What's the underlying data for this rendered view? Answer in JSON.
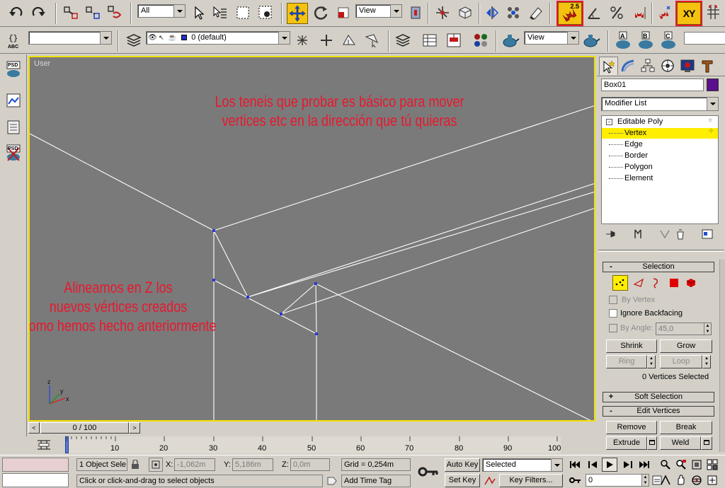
{
  "toolbar": {
    "selection_filter": "All",
    "ref_coord": "View",
    "snap_label": "2.5",
    "axis_label": "XY",
    "named_sel_placeholder": "",
    "pivot_view": "View",
    "render_a": "A",
    "render_b": "B",
    "render_c": "C"
  },
  "layer_bar": {
    "layer_name": "0 (default)",
    "name_field": "",
    "abc_label": "ABC"
  },
  "left_dock": {
    "psd1": "PSD",
    "psd2": "PSD"
  },
  "viewport": {
    "label": "User",
    "annotation_top": [
      "Los teneis que probar es básico para mover",
      "vertices etc en la dirección que tú quieras"
    ],
    "annotation_left": [
      "Alineamos en Z los",
      "nuevos vértices creados",
      "como hemos hecho anteriormente"
    ],
    "axis_x": "x",
    "axis_y": "y",
    "axis_z": "z"
  },
  "command_panel": {
    "object_name": "Box01",
    "object_color": "#5a0f8c",
    "modifier_list": "Modifier List",
    "stack": [
      {
        "label": "Editable Poly",
        "selected": false
      },
      {
        "label": "Vertex",
        "selected": true
      },
      {
        "label": "Edge",
        "selected": false
      },
      {
        "label": "Border",
        "selected": false
      },
      {
        "label": "Polygon",
        "selected": false
      },
      {
        "label": "Element",
        "selected": false
      }
    ],
    "selection": {
      "title": "Selection",
      "sign": "-",
      "by_vertex": "By Vertex",
      "ignore_backfacing": "Ignore Backfacing",
      "by_angle": "By Angle:",
      "angle_value": "45,0",
      "shrink": "Shrink",
      "grow": "Grow",
      "ring": "Ring",
      "loop": "Loop",
      "status": "0 Vertices Selected"
    },
    "soft_selection": {
      "title": "Soft Selection",
      "sign": "+"
    },
    "edit_vertices": {
      "title": "Edit Vertices",
      "sign": "-",
      "remove": "Remove",
      "break": "Break",
      "extrude": "Extrude",
      "weld": "Weld"
    }
  },
  "timeline": {
    "frame_display": "0 / 100",
    "ticks": [
      "0",
      "10",
      "20",
      "30",
      "40",
      "50",
      "60",
      "70",
      "80",
      "90",
      "100"
    ]
  },
  "status_bar": {
    "selection_count": "1 Object Sele",
    "x_label": "X:",
    "x_value": "-1,062m",
    "y_label": "Y:",
    "y_value": "5,186m",
    "z_label": "Z:",
    "z_value": "0,0m",
    "grid": "Grid = 0,254m",
    "auto_key": "Auto Key",
    "key_mode": "Selected",
    "set_key": "Set Key",
    "key_filters": "Key Filters...",
    "prompt": "Click or click-and-drag to select objects",
    "add_time_tag": "Add Time Tag",
    "current_frame": "0"
  },
  "colors": {
    "ui_gray": "#d4d0c8",
    "viewport_bg": "#7a7a7a",
    "active_border": "#f0e000",
    "highlight_red": "#e8182e",
    "snap_yellow": "#f4c20f",
    "stack_select": "#ffee00"
  }
}
